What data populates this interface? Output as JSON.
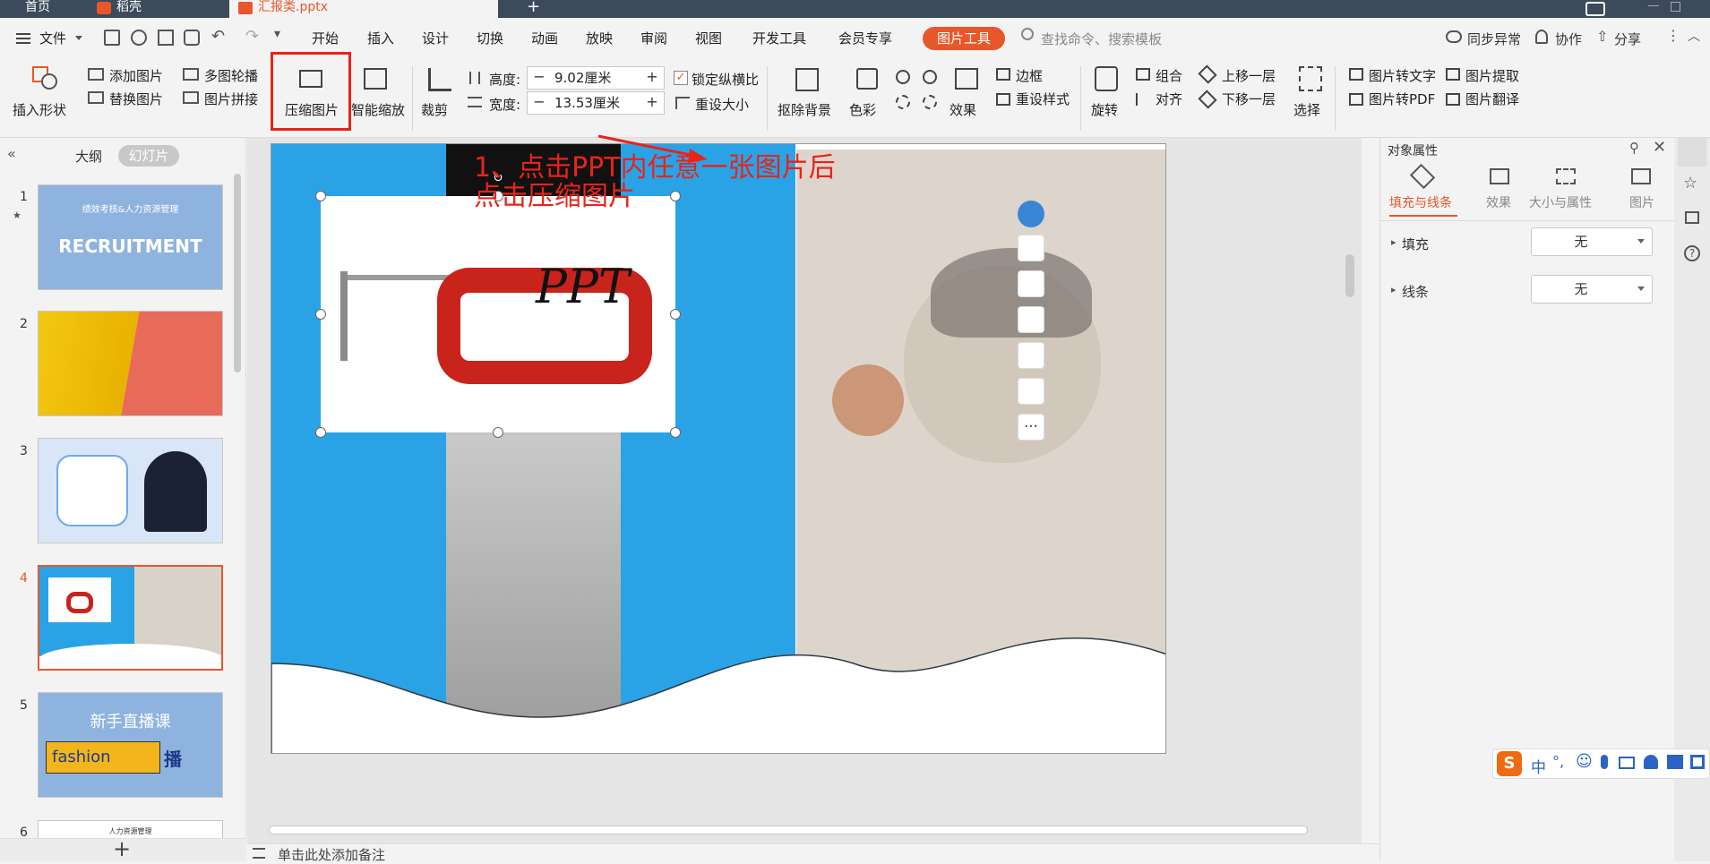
{
  "tabs": {
    "home": "首页",
    "docer": "稻壳",
    "file": "汇报类.pptx"
  },
  "menubar": {
    "file": "文件",
    "items": [
      "开始",
      "插入",
      "设计",
      "切换",
      "动画",
      "放映",
      "审阅",
      "视图",
      "开发工具",
      "会员专享"
    ],
    "active_tool": "图片工具",
    "search_placeholder": "查找命令、搜索模板",
    "sync": "同步异常",
    "collab": "协作",
    "share": "分享"
  },
  "ribbon": {
    "insert_shape": "插入形状",
    "add_picture": "添加图片",
    "replace_picture": "替换图片",
    "multi_carousel": "多图轮播",
    "picture_stitch": "图片拼接",
    "compress_picture": "压缩图片",
    "smart_zoom": "智能缩放",
    "crop": "裁剪",
    "height_label": "高度:",
    "height_value": "9.02厘米",
    "width_label": "宽度:",
    "width_value": "13.53厘米",
    "lock_ratio": "锁定纵横比",
    "reset_size": "重设大小",
    "remove_bg": "抠除背景",
    "color": "色彩",
    "effects": "效果",
    "border": "边框",
    "reset_style": "重设样式",
    "rotate": "旋转",
    "group": "组合",
    "align": "对齐",
    "bring_forward": "上移一层",
    "send_backward": "下移一层",
    "select": "选择",
    "pic_to_text": "图片转文字",
    "pic_to_pdf": "图片转PDF",
    "pic_extract": "图片提取",
    "pic_translate": "图片翻译"
  },
  "leftpanel": {
    "outline_tab": "大纲",
    "slides_tab": "幻灯片",
    "slides": [
      {
        "num": "1",
        "title": "绩效考核&人力资源管理",
        "big": "RECRUITMENT"
      },
      {
        "num": "2"
      },
      {
        "num": "3"
      },
      {
        "num": "4"
      },
      {
        "num": "5",
        "title": "新手直播课",
        "tag": "fashion",
        "suffix": "播"
      },
      {
        "num": "6",
        "title": "人力资源管理"
      }
    ]
  },
  "canvas": {
    "instruction_line1": "1、点击PPT内任意一张图片后",
    "instruction_line2": "点击压缩图片",
    "image_text": "PPT",
    "notes_placeholder": "单击此处添加备注"
  },
  "rightpanel": {
    "title": "对象属性",
    "tabs": [
      "填充与线条",
      "效果",
      "大小与属性",
      "图片"
    ],
    "fill_label": "填充",
    "fill_value": "无",
    "line_label": "线条",
    "line_value": "无"
  },
  "ime": {
    "label": "中"
  },
  "colors": {
    "accent": "#e8572a",
    "slide_blue": "#2aa3e6",
    "clamp_red": "#c8241c",
    "annotation_red": "#e8231a"
  }
}
